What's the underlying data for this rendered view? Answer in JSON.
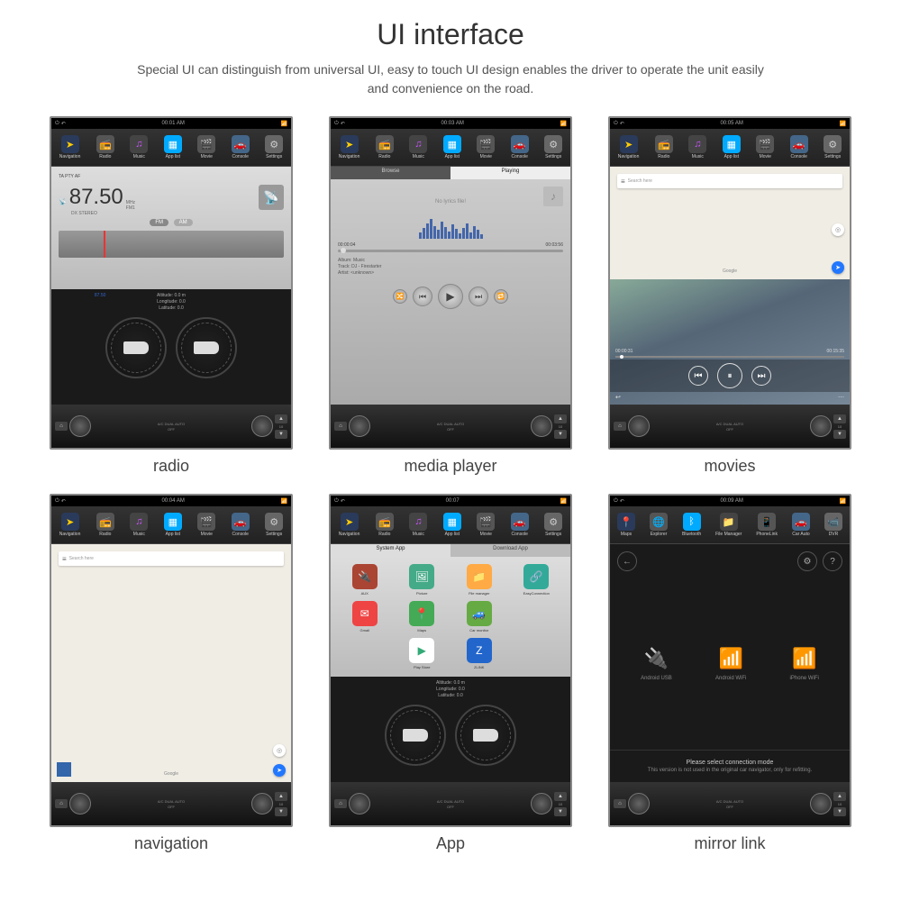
{
  "header": {
    "title": "UI interface",
    "subtitle": "Special UI can distinguish from universal UI, easy to touch UI design enables the driver to operate the unit easily and convenience on the road."
  },
  "nav": {
    "items": [
      "Navigation",
      "Radio",
      "Music",
      "App list",
      "Movie",
      "Console",
      "Settings"
    ],
    "items2": [
      "Maps",
      "Explorer",
      "Bluetooth",
      "File Manager",
      "PhoneLink",
      "Car Auto",
      "DVR"
    ]
  },
  "captions": [
    "radio",
    "media player",
    "movies",
    "navigation",
    "App",
    "mirror link"
  ],
  "times": [
    "00:01 AM",
    "00:03 AM",
    "00:05 AM",
    "00:04 AM",
    "00:07",
    "00:09 AM"
  ],
  "radio": {
    "buttons": "TA  PTY  AF",
    "freq": "87.50",
    "unit1": "MHz",
    "unit2": "FM1",
    "stereo": "DX  STEREO",
    "band_fm": "FM",
    "band_am": "AM",
    "dial_freq": "87.50"
  },
  "gps": {
    "alt": "Altitude: 0.0 m",
    "lon": "Longitude: 0.0",
    "lat": "Latitude: 0.0"
  },
  "media": {
    "tab1": "Browse",
    "tab2": "Playing",
    "nolyrics": "No lyrics file!",
    "t0": "00:00:04",
    "t1": "00:03:56",
    "album_l": "Album:",
    "album_v": "Music",
    "track_l": "Track:",
    "track_v": "DJ - Firestarter",
    "artist_l": "Artist:",
    "artist_v": "<unknown>"
  },
  "map": {
    "search": "Search here",
    "logo": "Google"
  },
  "movie": {
    "t0": "00:00:31",
    "t1": "00:15:35"
  },
  "apps": {
    "tab1": "System App",
    "tab2": "Download App",
    "items": [
      "AUX",
      "Picture",
      "File manager",
      "EasyConnection",
      "Gmail",
      "Maps",
      "Car monitor",
      "",
      "",
      "Play Store",
      "ZLINK"
    ]
  },
  "mirror": {
    "opt1": "Android USB",
    "opt2": "Android WiFi",
    "opt3": "iPhone WiFi",
    "msg1": "Please select connection mode",
    "msg2": "This version is not used in the original car navigator, only for refitting."
  },
  "controlbar": {
    "ac": "A/C  DUAL  AUTO",
    "off": "OFF",
    "vol": "10"
  }
}
